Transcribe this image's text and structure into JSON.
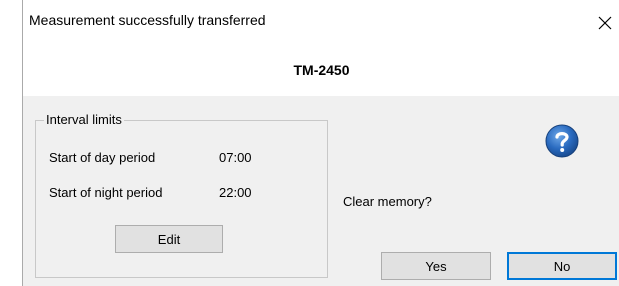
{
  "window": {
    "title": "Measurement successfully transferred",
    "close_glyph": "✕"
  },
  "header": {
    "device_name": "TM-2450"
  },
  "interval_limits": {
    "legend": "Interval limits",
    "rows": [
      {
        "label": "Start of day period",
        "value": "07:00"
      },
      {
        "label": "Start of night period",
        "value": "22:00"
      }
    ],
    "edit_label": "Edit"
  },
  "prompt": {
    "icon": "help-question-icon",
    "icon_color": "#1f5fa8",
    "question": "Clear memory?"
  },
  "buttons": {
    "yes_label": "Yes",
    "no_label": "No",
    "default_accent": "#0078d7"
  }
}
